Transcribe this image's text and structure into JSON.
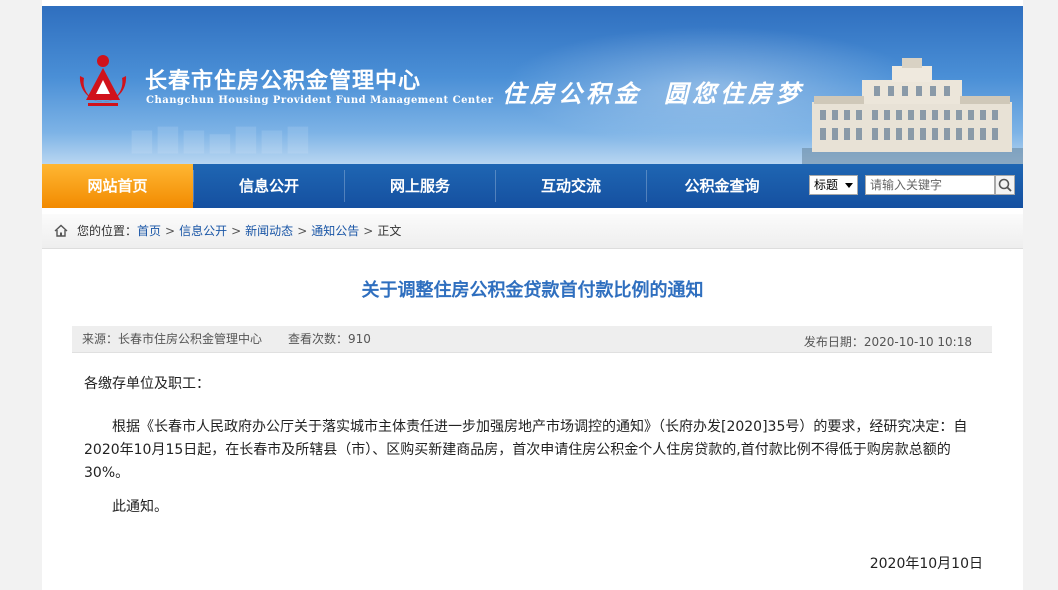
{
  "header": {
    "site_name": "长春市住房公积金管理中心",
    "site_name_en": "Changchun Housing Provident Fund Management Center",
    "slogan_left": "住房公积金",
    "slogan_right": "圆您住房梦",
    "emblem_color": "#d0121b"
  },
  "nav": {
    "items": [
      {
        "label": "网站首页",
        "active": true
      },
      {
        "label": "信息公开",
        "active": false
      },
      {
        "label": "网上服务",
        "active": false
      },
      {
        "label": "互动交流",
        "active": false
      },
      {
        "label": "公积金查询",
        "active": false
      }
    ],
    "active_color": "#f5a01a",
    "bar_color": "#1a5aa8"
  },
  "search": {
    "scope_selected": "标题",
    "placeholder": "请输入关键字",
    "icon": "magnifier-icon"
  },
  "breadcrumb": {
    "prefix": "您的位置：",
    "items": [
      "首页",
      "信息公开",
      "新闻动态",
      "通知公告"
    ],
    "current": "正文",
    "separator": ">",
    "icon": "home-icon"
  },
  "article": {
    "title": "关于调整住房公积金贷款首付款比例的通知",
    "source_label": "来源：",
    "source": "长春市住房公积金管理中心",
    "views_label": "查看次数：",
    "views": "910",
    "date_label": "发布日期：",
    "date": "2020-10-10 10:18",
    "salutation": "各缴存单位及职工：",
    "body": "根据《长春市人民政府办公厅关于落实城市主体责任进一步加强房地产市场调控的通知》（长府办发[2020]35号）的要求，经研究决定：自2020年10月15日起，在长春市及所辖县（市）、区购买新建商品房，首次申请住房公积金个人住房贷款的,首付款比例不得低于购房款总额的30%。",
    "closing": "此通知。",
    "sign_date": "2020年10月10日",
    "title_color": "#2f6fbf"
  }
}
